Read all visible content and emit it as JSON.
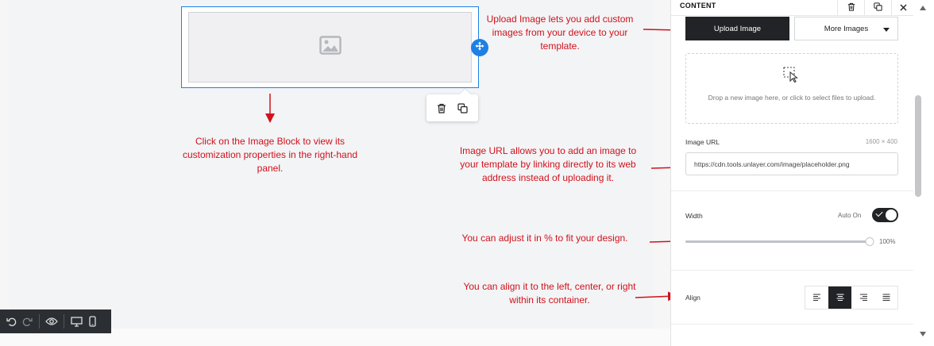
{
  "canvas": {
    "image_block": {
      "icon": "image-placeholder-icon"
    },
    "move_handle_icon": "move-arrows-icon",
    "block_tools": {
      "delete_icon": "trash-icon",
      "duplicate_icon": "duplicate-icon"
    }
  },
  "annotations": [
    "Upload Image lets you add custom images from your device to your template.",
    "Click on the Image Block to view its customization properties in the right-hand panel.",
    "Image URL allows you to add an image to your template by linking directly to its web address instead of uploading it.",
    "You can adjust it in % to fit your design.",
    "You can align it to the left, center, or right within its container."
  ],
  "annotation_color": "#d0121b",
  "bottom_toolbar": {
    "icons": [
      "undo-icon",
      "redo-icon",
      "preview-eye-icon",
      "desktop-icon",
      "mobile-icon"
    ]
  },
  "panel": {
    "title": "CONTENT",
    "header_icons": [
      "trash-icon",
      "duplicate-icon",
      "close-icon"
    ],
    "upload_button": "Upload Image",
    "more_images_button": "More Images",
    "dropzone_text": "Drop a new image here, or click to select files to upload.",
    "image_url": {
      "label": "Image URL",
      "dimensions": "1600 × 400",
      "value": "https://cdn.tools.unlayer.com/image/placeholder.png"
    },
    "width": {
      "label": "Width",
      "auto_label": "Auto On",
      "auto_on": true,
      "value_text": "100%",
      "percent": 100
    },
    "align": {
      "label": "Align",
      "options": [
        "align-left-icon",
        "align-center-icon",
        "align-right-icon",
        "align-justify-icon"
      ],
      "selected": 1
    }
  },
  "colors": {
    "accent_blue": "#1e80e6",
    "dark": "#222326"
  }
}
